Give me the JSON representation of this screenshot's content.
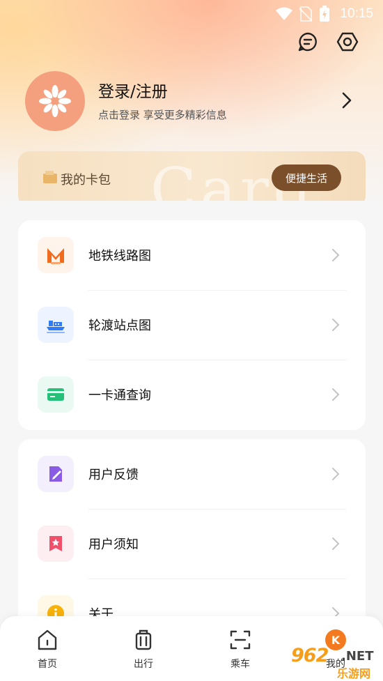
{
  "status_bar": {
    "time": "10:15"
  },
  "header": {
    "message_icon": "message-icon",
    "settings_icon": "settings-icon"
  },
  "profile": {
    "title": "登录/注册",
    "subtitle": "点击登录 享受更多精彩信息"
  },
  "wallet": {
    "label": "我的卡包",
    "watermark": "Card",
    "quick_button": "便捷生活"
  },
  "menu_group_1": [
    {
      "label": "地铁线路图",
      "icon": "metro-icon",
      "color": "#f16b1f",
      "bg": "#fff4ec"
    },
    {
      "label": "轮渡站点图",
      "icon": "ferry-icon",
      "color": "#2f7cf6",
      "bg": "#eef4ff"
    },
    {
      "label": "一卡通查询",
      "icon": "card-icon",
      "color": "#27c07a",
      "bg": "#eafaf2"
    }
  ],
  "menu_group_2": [
    {
      "label": "用户反馈",
      "icon": "feedback-icon",
      "color": "#8a5ce6",
      "bg": "#f4effd"
    },
    {
      "label": "用户须知",
      "icon": "notice-icon",
      "color": "#f0506a",
      "bg": "#fdeff1"
    },
    {
      "label": "关于",
      "icon": "info-icon",
      "color": "#f6b20a",
      "bg": "#fff8e6"
    }
  ],
  "bottom_nav": [
    {
      "label": "首页",
      "icon": "home-icon"
    },
    {
      "label": "出行",
      "icon": "luggage-icon"
    },
    {
      "label": "乘车",
      "icon": "scan-icon"
    },
    {
      "label": "我的",
      "icon": "profile-icon"
    }
  ],
  "watermark": {
    "number": "962",
    "net": ".NET",
    "site": "乐游网"
  }
}
